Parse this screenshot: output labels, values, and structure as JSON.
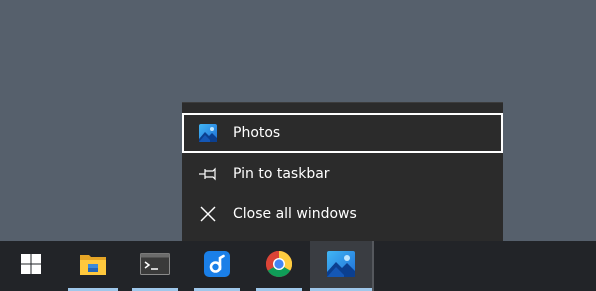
{
  "jumplist": {
    "app_item": {
      "label": "Photos",
      "icon": "photos-icon"
    },
    "tasks": [
      {
        "label": "Pin to taskbar",
        "icon": "pin-icon"
      },
      {
        "label": "Close all windows",
        "icon": "close-icon"
      }
    ]
  },
  "taskbar": {
    "buttons": [
      {
        "name": "start",
        "icon": "windows-logo-icon",
        "running": false
      },
      {
        "name": "file-explorer",
        "icon": "folder-icon",
        "running": true
      },
      {
        "name": "terminal",
        "icon": "terminal-icon",
        "running": true
      },
      {
        "name": "app-d",
        "icon": "d-app-icon",
        "running": true
      },
      {
        "name": "chrome",
        "icon": "chrome-icon",
        "running": true
      },
      {
        "name": "photos",
        "icon": "photos-icon",
        "running": true,
        "active": true
      }
    ]
  },
  "colors": {
    "desktop": "#56606c",
    "menu_bg": "#2b2b2b",
    "taskbar_bg": "#222428",
    "accent_underline": "#9fc7ea"
  }
}
